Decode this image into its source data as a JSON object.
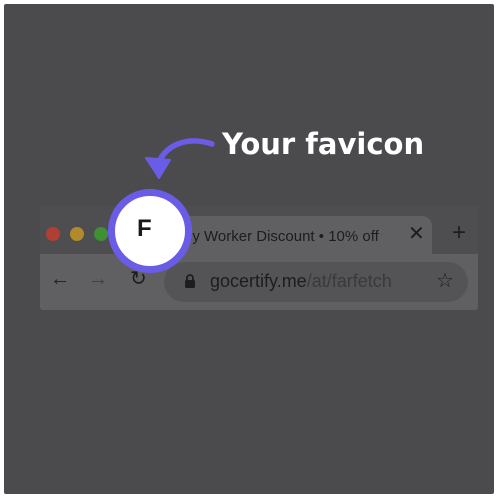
{
  "callout": {
    "text": "Your favicon"
  },
  "tab": {
    "favicon_letter": "F",
    "title": "Key Worker Discount • 10% off",
    "close_glyph": "✕"
  },
  "tabstrip": {
    "new_tab_glyph": "+"
  },
  "toolbar": {
    "back_glyph": "←",
    "forward_glyph": "→",
    "reload_glyph": "↻",
    "url_host": "gocertify.me",
    "url_path": "/at/farfetch",
    "star_glyph": "☆"
  },
  "colors": {
    "highlight": "#6b5ce7",
    "overlay": "#4b4b4d"
  },
  "icons": [
    "back-arrow-icon",
    "forward-arrow-icon",
    "reload-icon",
    "lock-icon",
    "bookmark-star-icon",
    "close-icon",
    "plus-icon",
    "curved-arrow-icon"
  ]
}
